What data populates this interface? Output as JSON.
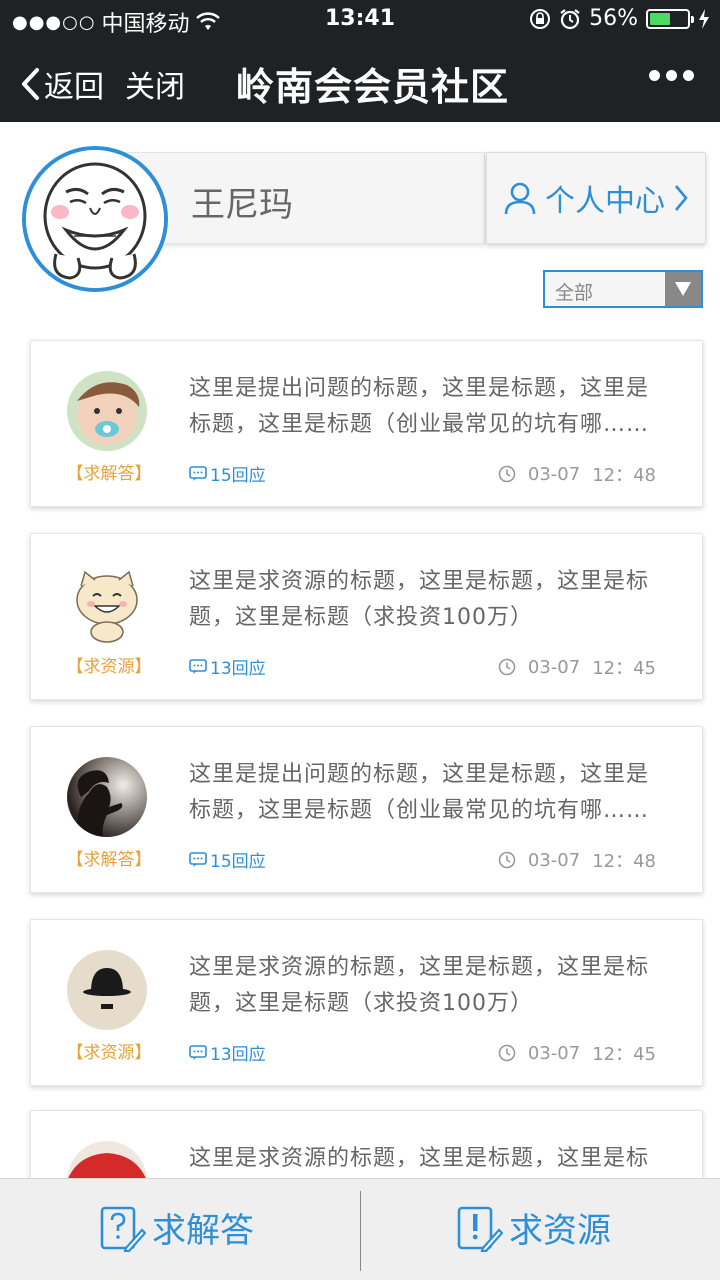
{
  "status_bar": {
    "signal": "●●●○○",
    "carrier": "中国移动",
    "time": "13:41",
    "battery": "56%",
    "battery_level": 0.56
  },
  "nav": {
    "back": "返回",
    "close": "关闭",
    "title": "岭南会会员社区"
  },
  "profile": {
    "name": "王尼玛",
    "center_label": "个人中心"
  },
  "filter": {
    "value": "全部"
  },
  "posts": [
    {
      "tag": "【求解答】",
      "title": "这里是提出问题的标题，这里是标题，这里是标题，这里是标题（创业最常见的坑有哪……",
      "replies": "15回应",
      "date": "03-07",
      "time": "12：48"
    },
    {
      "tag": "【求资源】",
      "title": "这里是求资源的标题，这里是标题，这里是标题，这里是标题（求投资100万）",
      "replies": "13回应",
      "date": "03-07",
      "time": "12：45"
    },
    {
      "tag": "【求解答】",
      "title": "这里是提出问题的标题，这里是标题，这里是标题，这里是标题（创业最常见的坑有哪……",
      "replies": "15回应",
      "date": "03-07",
      "time": "12：48"
    },
    {
      "tag": "【求资源】",
      "title": "这里是求资源的标题，这里是标题，这里是标题，这里是标题（求投资100万）",
      "replies": "13回应",
      "date": "03-07",
      "time": "12：45"
    },
    {
      "tag": "",
      "title": "这里是求资源的标题，这里是标题，这里是标题，这里是标",
      "replies": "",
      "date": "",
      "time": ""
    }
  ],
  "bottom": {
    "ask_label": "求解答",
    "resource_label": "求资源"
  },
  "colors": {
    "accent": "#2d8fd8",
    "tag": "#e8a23a",
    "dark_bar": "#1f2224"
  }
}
